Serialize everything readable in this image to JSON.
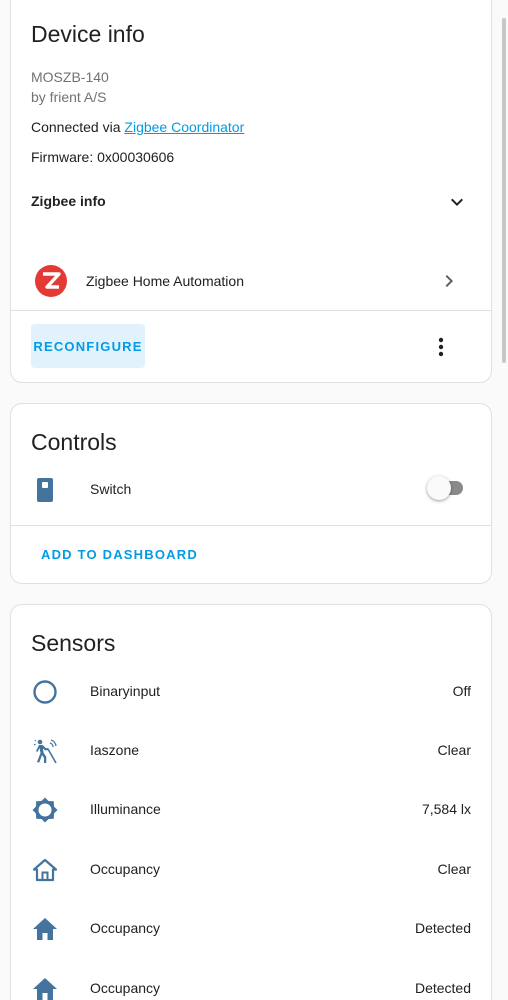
{
  "device_info": {
    "title": "Device info",
    "model": "MOSZB-140",
    "manufacturer": "by frient A/S",
    "connected_prefix": "Connected via",
    "connected_link": "Zigbee Coordinator",
    "firmware": "Firmware: 0x00030606",
    "zigbee_info_label": "Zigbee info",
    "integration_label": "Zigbee Home Automation",
    "reconfigure_label": "RECONFIGURE"
  },
  "controls": {
    "title": "Controls",
    "items": [
      {
        "label": "Switch",
        "icon": "switch-icon",
        "state": "off"
      }
    ],
    "add_to_dashboard_label": "ADD TO DASHBOARD"
  },
  "sensors": {
    "title": "Sensors",
    "items": [
      {
        "label": "Binaryinput",
        "value": "Off",
        "icon": "circle-outline-icon"
      },
      {
        "label": "Iaszone",
        "value": "Clear",
        "icon": "motion-sensor-icon"
      },
      {
        "label": "Illuminance",
        "value": "7,584 lx",
        "icon": "brightness-icon"
      },
      {
        "label": "Occupancy",
        "value": "Clear",
        "icon": "home-outline-icon"
      },
      {
        "label": "Occupancy",
        "value": "Detected",
        "icon": "home-icon"
      },
      {
        "label": "Occupancy",
        "value": "Detected",
        "icon": "home-icon"
      }
    ]
  },
  "colors": {
    "accent": "#039be5",
    "icon": "#44739e",
    "zigbee_red": "#e53935"
  }
}
